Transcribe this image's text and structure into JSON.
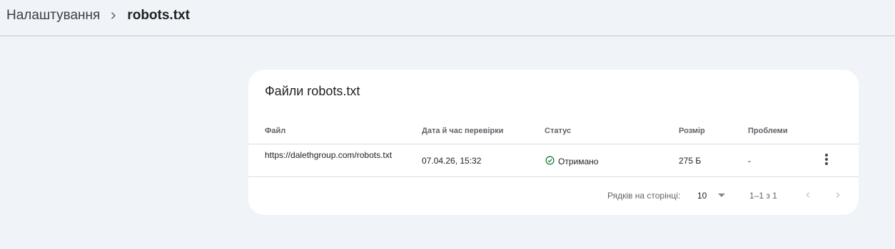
{
  "breadcrumb": {
    "parent": "Налаштування",
    "current": "robots.txt"
  },
  "card": {
    "title": "Файли robots.txt",
    "columns": {
      "file": "Файл",
      "checked": "Дата й час перевірки",
      "status": "Статус",
      "size": "Розмір",
      "issues": "Проблеми"
    },
    "rows": [
      {
        "file": "https://dalethgroup.com/robots.txt",
        "checked": "07.04.26, 15:32",
        "status": "Отримано",
        "size": "275 Б",
        "issues": "-"
      }
    ]
  },
  "pagination": {
    "rows_per_page_label": "Рядків на сторінці:",
    "rows_per_page_value": "10",
    "range": "1–1 з 1"
  },
  "colors": {
    "background": "#f0f4f9",
    "card": "#ffffff",
    "status_ok": "#188038",
    "muted": "#5f6368"
  },
  "icons": {
    "separator": "chevron-right-icon",
    "status": "check-circle-icon",
    "more": "more-vert-icon",
    "dropdown": "dropdown-arrow-icon",
    "prev": "chevron-left-icon",
    "next": "chevron-right-icon"
  }
}
